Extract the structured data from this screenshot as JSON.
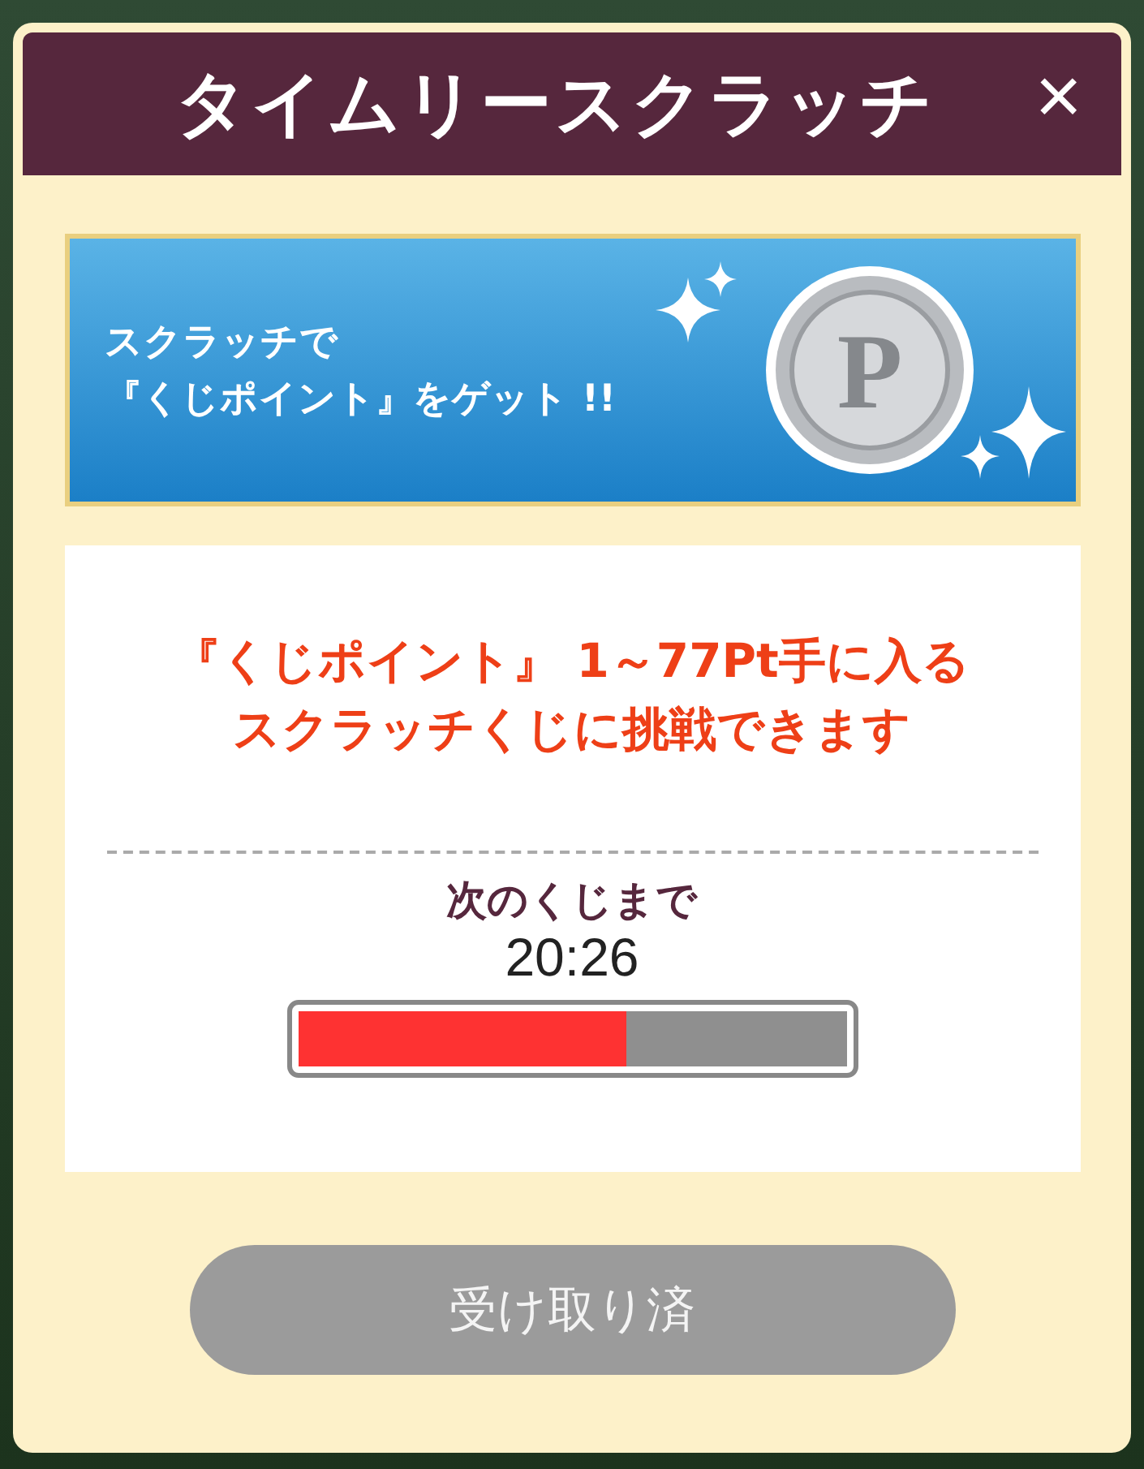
{
  "dialog": {
    "title": "タイムリースクラッチ",
    "close": "×"
  },
  "banner": {
    "lines": [
      "スクラッチで",
      "『くじポイント』をゲット !!"
    ],
    "coin_letter": "P"
  },
  "info": {
    "message": [
      "『くじポイント』 1～77Pt手に入る",
      "スクラッチくじに挑戦できます"
    ],
    "next_label": "次のくじまで",
    "countdown": "20:26",
    "progress": {
      "level": 0.6
    }
  },
  "button": {
    "label": "受け取り済",
    "disabled": true
  }
}
